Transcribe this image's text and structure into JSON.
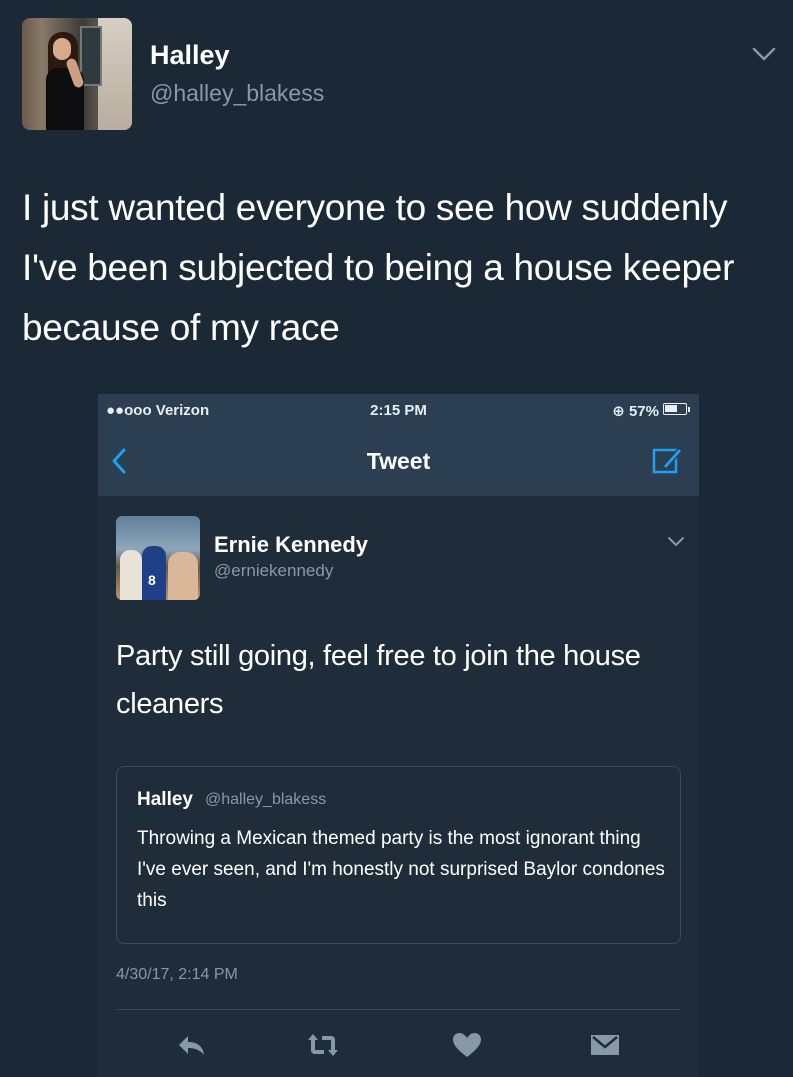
{
  "outer_tweet": {
    "name": "Halley",
    "handle": "@halley_blakess",
    "text": "I just wanted everyone to see how suddenly I've been subjected to being a house keeper because of my race",
    "avatar_icon": "profile-photo",
    "menu_icon": "chevron-down-icon"
  },
  "screenshot": {
    "status_bar": {
      "carrier": "●●ooo Verizon",
      "time": "2:15 PM",
      "battery": "57%",
      "battery_level": 0.57
    },
    "nav": {
      "title": "Tweet",
      "back_icon": "back-chevron-icon",
      "compose_icon": "compose-icon"
    },
    "tweet": {
      "name": "Ernie Kennedy",
      "handle": "@erniekennedy",
      "avatar_number": "8",
      "text": "Party still going, feel free to join the house cleaners",
      "timestamp": "4/30/17, 2:14 PM",
      "quoted": {
        "name": "Halley",
        "handle": "@halley_blakess",
        "text": "Throwing a Mexican themed party is the most ignorant thing I've ever seen, and I'm honestly not surprised Baylor condones this"
      },
      "actions": [
        "reply-icon",
        "retweet-icon",
        "like-icon",
        "direct-message-icon"
      ]
    }
  },
  "colors": {
    "background": "#1b2836",
    "nav_bar": "#2b3e52",
    "link_blue": "#1da1f2",
    "secondary_text": "#8899a6"
  }
}
